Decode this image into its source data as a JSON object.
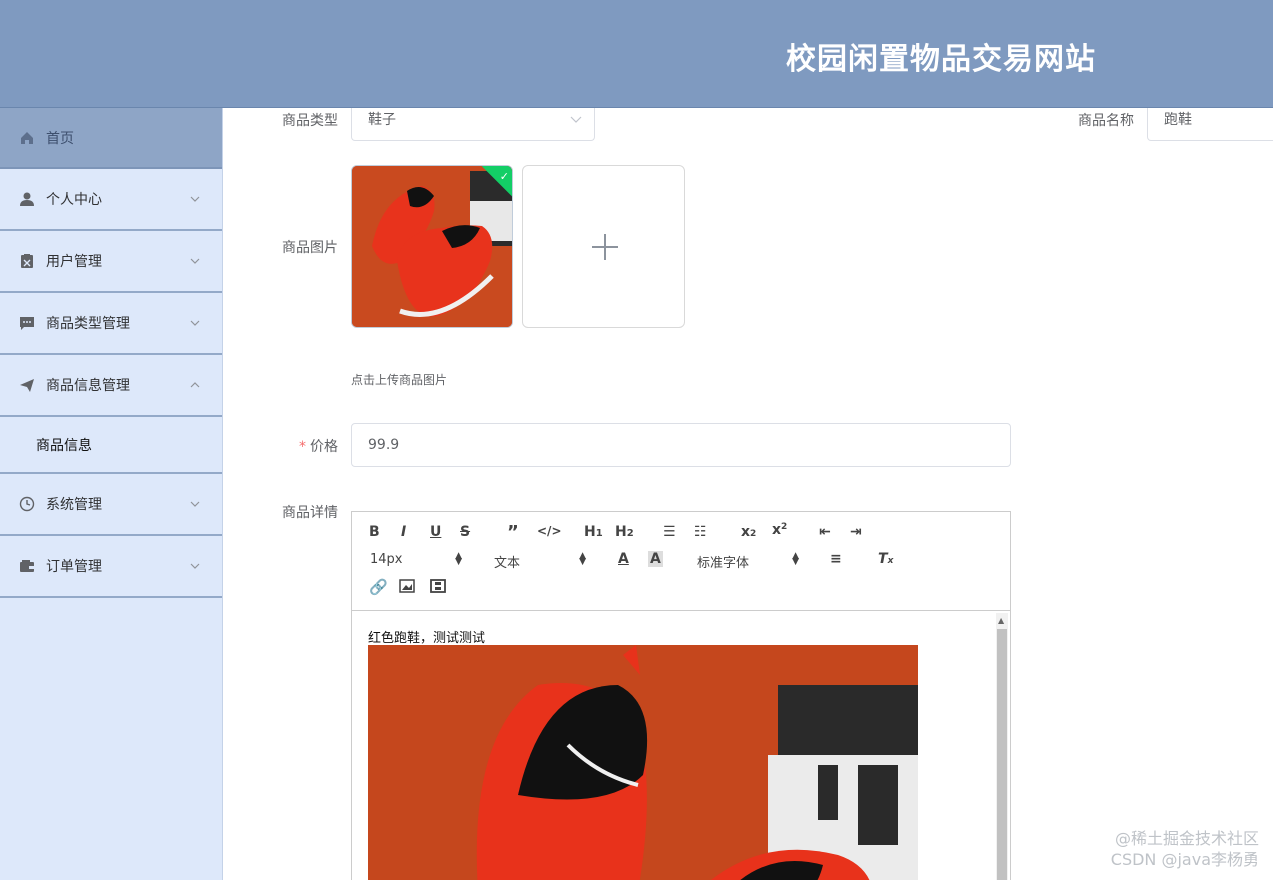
{
  "header": {
    "title": "校园闲置物品交易网站"
  },
  "sidebar": {
    "items": [
      {
        "label": "首页",
        "icon": "home-icon"
      },
      {
        "label": "个人中心",
        "icon": "user-icon"
      },
      {
        "label": "用户管理",
        "icon": "clipboard-icon"
      },
      {
        "label": "商品类型管理",
        "icon": "chat-icon"
      },
      {
        "label": "商品信息管理",
        "icon": "send-icon"
      },
      {
        "label": "系统管理",
        "icon": "clock-icon"
      },
      {
        "label": "订单管理",
        "icon": "wallet-icon"
      }
    ],
    "sub_item": {
      "label": "商品信息"
    }
  },
  "form": {
    "type_label": "商品类型",
    "type_value": "鞋子",
    "name_label": "商品名称",
    "name_value": "跑鞋",
    "image_label": "商品图片",
    "upload_tip": "点击上传商品图片",
    "price_required": "*",
    "price_label": "价格",
    "price_value": "99.9",
    "detail_label": "商品详情"
  },
  "editor": {
    "font_size": "14px",
    "header_select": "文本",
    "font_family": "标准字体",
    "content_text": "红色跑鞋，测试测试"
  },
  "watermark": {
    "line1": "@稀土掘金技术社区",
    "line2": "CSDN @java李杨勇"
  },
  "colors": {
    "header_bg": "#7f9ac0",
    "sidebar_bg": "#dde8fa",
    "sidebar_active_bg": "#8ea5c6",
    "success_badge": "#13ce66",
    "required_star": "#f56c6c"
  }
}
